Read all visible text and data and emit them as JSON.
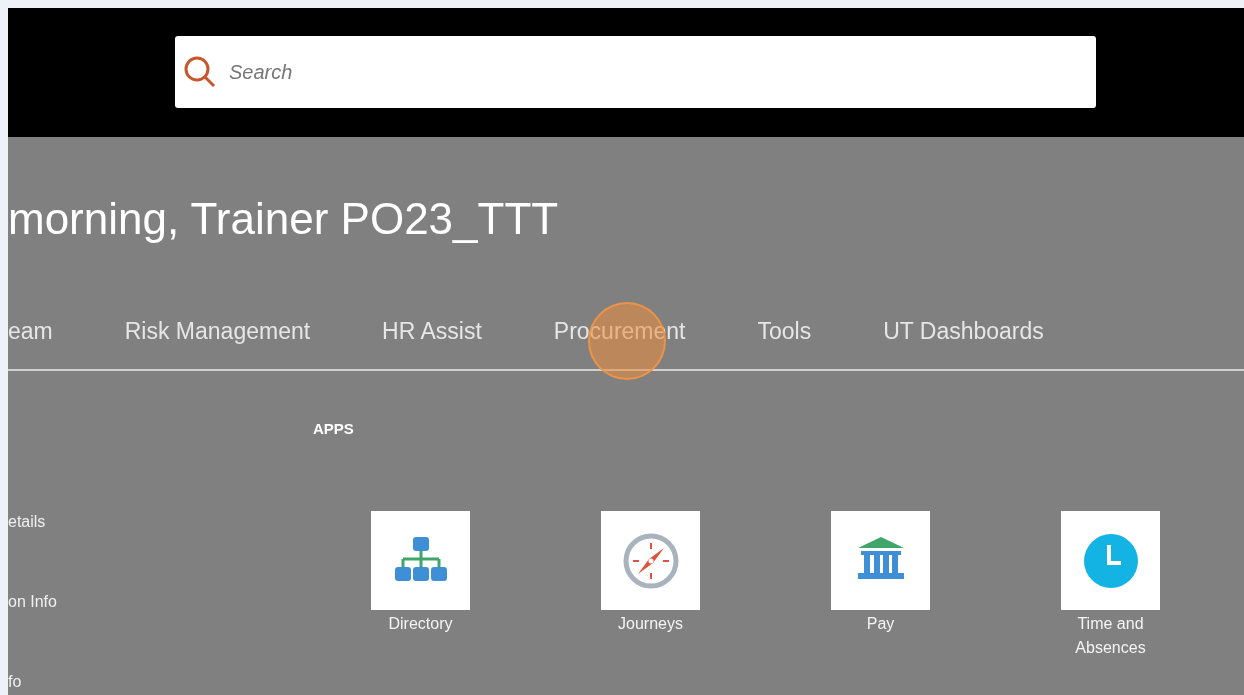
{
  "search": {
    "placeholder": "Search"
  },
  "greeting": "morning, Trainer PO23_TTT",
  "tabs": [
    {
      "label": "eam",
      "selected": false
    },
    {
      "label": "Risk Management",
      "selected": false
    },
    {
      "label": "HR Assist",
      "selected": false
    },
    {
      "label": "Procurement",
      "selected": false
    },
    {
      "label": "Tools",
      "selected": false
    },
    {
      "label": "UT Dashboards",
      "selected": false
    }
  ],
  "side_links": [
    "etails",
    "on Info",
    "fo"
  ],
  "apps": {
    "heading": "APPS",
    "items": [
      {
        "label": "Directory",
        "kind": "directory"
      },
      {
        "label": "Journeys",
        "kind": "compass"
      },
      {
        "label": "Pay",
        "kind": "bank"
      },
      {
        "label": "Time and Absences",
        "kind": "clock"
      }
    ]
  }
}
